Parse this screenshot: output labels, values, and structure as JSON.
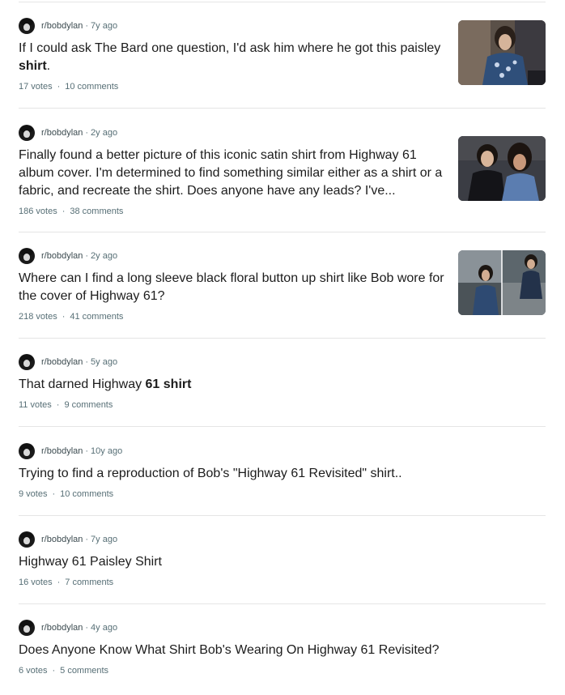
{
  "posts": [
    {
      "subreddit": "r/bobdylan",
      "age": "7y ago",
      "title_before": "If I could ask The Bard one question, I'd ask him where he got this paisley ",
      "title_bold": "shirt",
      "title_after": ".",
      "votes": "17 votes",
      "comments": "10 comments",
      "thumbnail": "photo"
    },
    {
      "subreddit": "r/bobdylan",
      "age": "2y ago",
      "title": "Finally found a better picture of this iconic satin shirt from Highway 61 album cover. I'm determined to find something similar either as a shirt or a fabric, and recreate the shirt. Does anyone have any leads? I've...",
      "votes": "186 votes",
      "comments": "38 comments",
      "thumbnail": "photo"
    },
    {
      "subreddit": "r/bobdylan",
      "age": "2y ago",
      "title": "Where can I find a long sleeve black floral button up shirt like Bob wore for the cover of Highway 61?",
      "votes": "218 votes",
      "comments": "41 comments",
      "thumbnail": "photo"
    },
    {
      "subreddit": "r/bobdylan",
      "age": "5y ago",
      "title_before": "That darned Highway ",
      "title_bold": "61 shirt",
      "title_after": "",
      "votes": "11 votes",
      "comments": "9 comments"
    },
    {
      "subreddit": "r/bobdylan",
      "age": "10y ago",
      "title": "Trying to find a reproduction of Bob's \"Highway 61 Revisited\" shirt..",
      "votes": "9 votes",
      "comments": "10 comments"
    },
    {
      "subreddit": "r/bobdylan",
      "age": "7y ago",
      "title": "Highway 61 Paisley Shirt",
      "votes": "16 votes",
      "comments": "7 comments"
    },
    {
      "subreddit": "r/bobdylan",
      "age": "4y ago",
      "title": "Does Anyone Know What Shirt Bob's Wearing On Highway 61 Revisited?",
      "votes": "6 votes",
      "comments": "5 comments"
    }
  ],
  "separator_dot": "·",
  "icons": {
    "avatar": "subreddit-avatar-icon"
  },
  "colors": {
    "text": "#1c1c1c",
    "meta": "#576f76",
    "divider": "#e5e5e5"
  }
}
